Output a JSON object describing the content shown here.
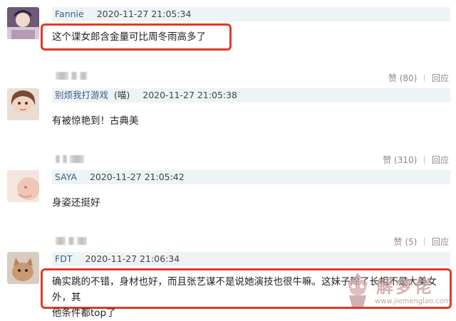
{
  "comments": [
    {
      "user": "Fannie",
      "note": "",
      "time": "2020-11-27 21:05:34",
      "text": "这个谍女郎含金量可比周冬雨高多了",
      "likes": "赞 (80)",
      "reply": "回应"
    },
    {
      "user": "别烦我打游戏",
      "note": "(喵)",
      "time": "2020-11-27 21:05:38",
      "text": "有被惊艳到！古典美",
      "likes": "赞 (310)",
      "reply": "回应"
    },
    {
      "user": "SAYA",
      "note": "",
      "time": "2020-11-27 21:05:42",
      "text": "身姿还挺好",
      "likes": "赞 (5)",
      "reply": "回应"
    },
    {
      "user": "FDT",
      "note": "",
      "time": "2020-11-27 21:06:34",
      "text_line1": "确实跳的不错，身材也好，而且张艺谋不是说她演技也很牛嘛。这妹子除了长相不是大美女外，其",
      "text_line2": "他条件都top了"
    }
  ],
  "watermark": {
    "title": "解梦佬",
    "url": "www.jiemenglao.com"
  },
  "colors": {
    "highlight": "#e23a25",
    "username": "#3b5f86",
    "header_bg": "#eef3f6"
  }
}
